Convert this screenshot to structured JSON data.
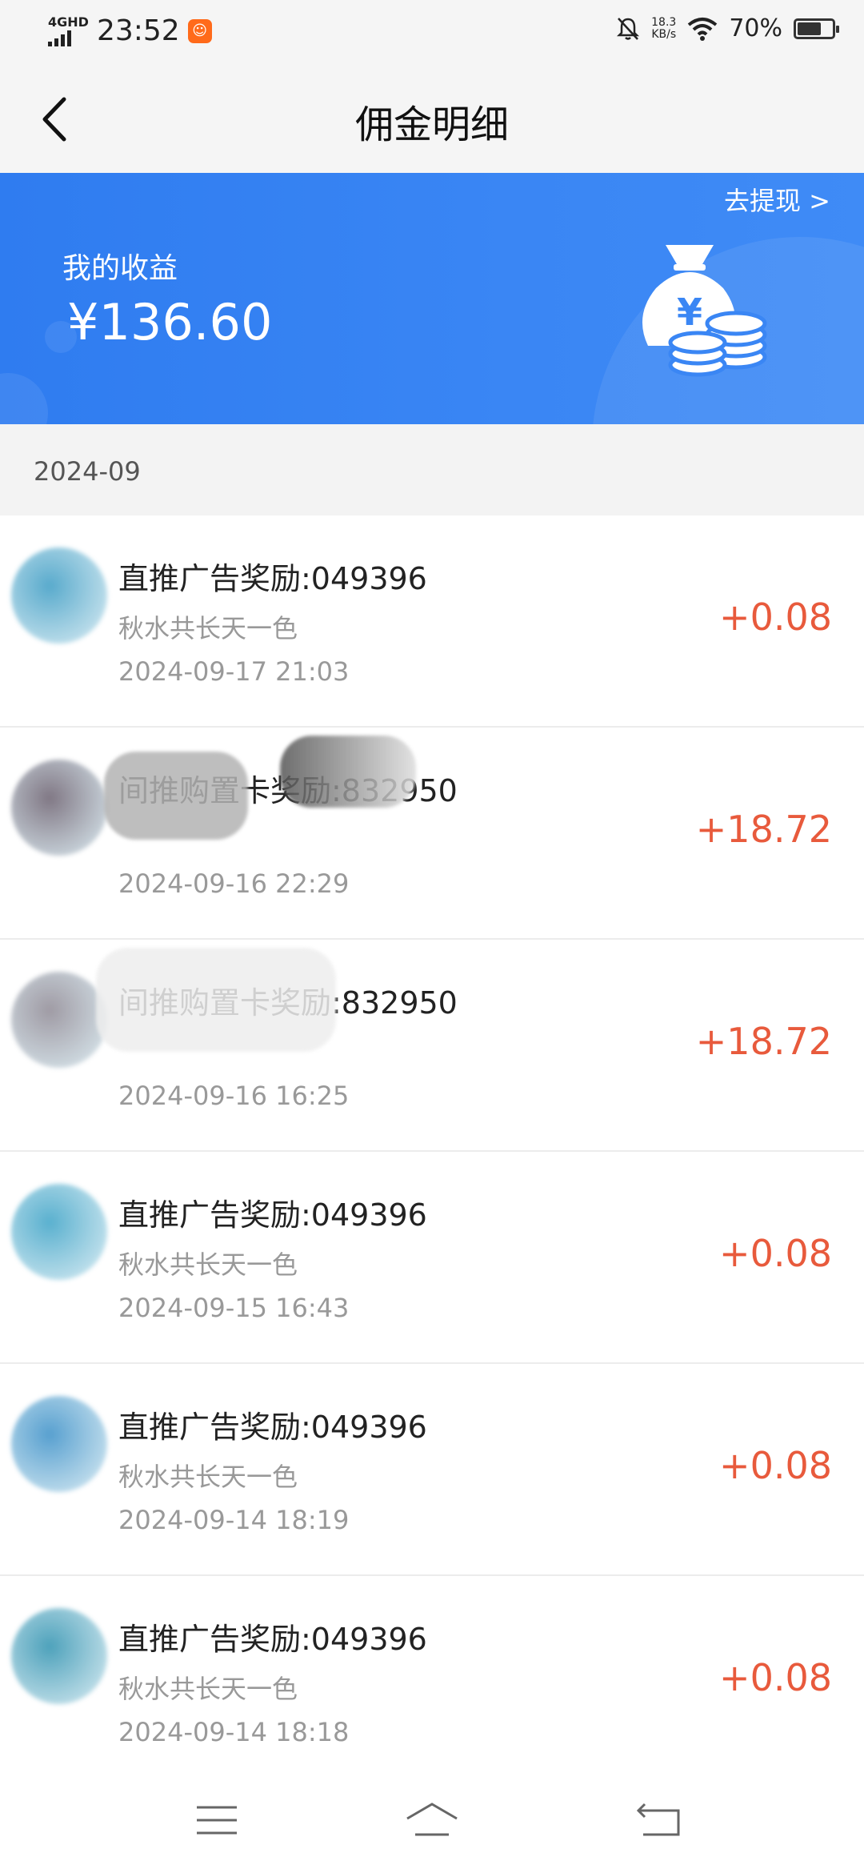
{
  "status_bar": {
    "network": "4GHD",
    "time": "23:52",
    "speed_value": "18.3",
    "speed_unit": "KB/s",
    "battery_percent": "70%",
    "battery_level": 0.7
  },
  "nav": {
    "title": "佣金明细",
    "back_icon": "chevron-left-icon"
  },
  "banner": {
    "withdraw_label": "去提现 >",
    "earnings_label": "我的收益",
    "earnings_amount": "¥136.60",
    "icon": "money-bag-icon",
    "color": "#3a86f4"
  },
  "month": "2024-09",
  "records": [
    {
      "title": "直推广告奖励:049396",
      "subtitle": "秋水共长天一色",
      "time": "2024-09-17 21:03",
      "amount": "+0.08",
      "avatar_color": "#3c9cc4"
    },
    {
      "title": "间推购置卡奖励:832950",
      "subtitle": "",
      "time": "2024-09-16 22:29",
      "amount": "+18.72",
      "avatar_color": "#6b6170"
    },
    {
      "title": "间推购置卡奖励:832950",
      "subtitle": "",
      "time": "2024-09-16 16:25",
      "amount": "+18.72",
      "avatar_color": "#8f8a95"
    },
    {
      "title": "直推广告奖励:049396",
      "subtitle": "秋水共长天一色",
      "time": "2024-09-15 16:43",
      "amount": "+0.08",
      "avatar_color": "#3da3c7"
    },
    {
      "title": "直推广告奖励:049396",
      "subtitle": "秋水共长天一色",
      "time": "2024-09-14 18:19",
      "amount": "+0.08",
      "avatar_color": "#3b90c8"
    },
    {
      "title": "直推广告奖励:049396",
      "subtitle": "秋水共长天一色",
      "time": "2024-09-14 18:18",
      "amount": "+0.08",
      "avatar_color": "#2f92b0"
    }
  ],
  "amount_color": "#e85a3c",
  "system_nav": {
    "menu_icon": "menu-icon",
    "home_icon": "home-icon",
    "back_icon": "back-icon"
  }
}
